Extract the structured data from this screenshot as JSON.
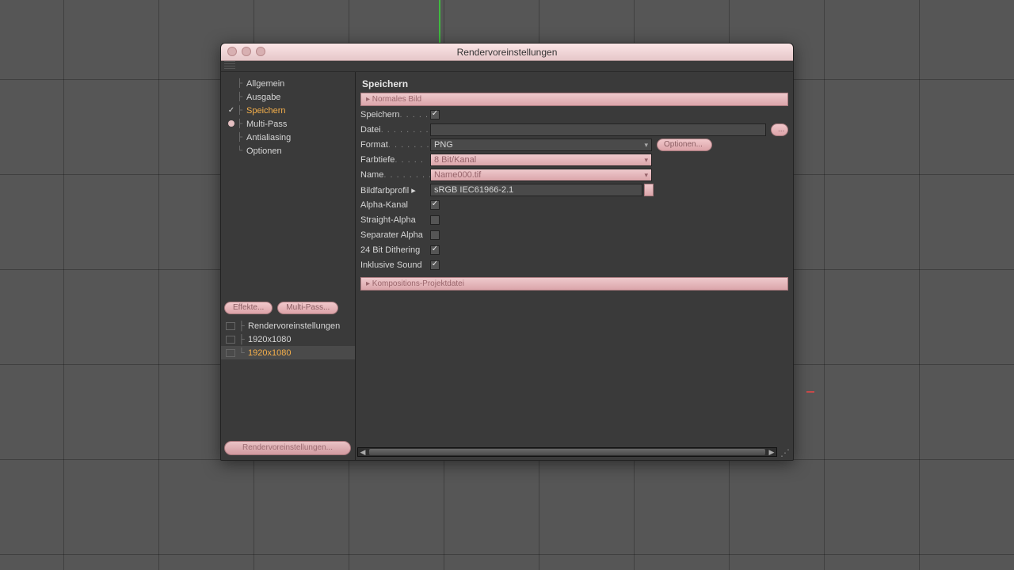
{
  "window": {
    "title": "Rendervoreinstellungen"
  },
  "nav": {
    "items": [
      {
        "label": "Allgemein",
        "check": "",
        "active": false
      },
      {
        "label": "Ausgabe",
        "check": "",
        "active": false
      },
      {
        "label": "Speichern",
        "check": "✓",
        "active": true
      },
      {
        "label": "Multi-Pass",
        "check": "radio",
        "active": false
      },
      {
        "label": "Antialiasing",
        "check": "",
        "active": false
      },
      {
        "label": "Optionen",
        "check": "",
        "active": false
      }
    ]
  },
  "side_buttons": {
    "effects": "Effekte...",
    "multipass": "Multi-Pass..."
  },
  "presets": {
    "items": [
      {
        "label": "Rendervoreinstellungen",
        "active": false
      },
      {
        "label": "1920x1080",
        "active": false
      },
      {
        "label": "1920x1080",
        "active": true
      }
    ]
  },
  "footer_button": "Rendervoreinstellungen...",
  "panel": {
    "title": "Speichern",
    "section1": "▸ Normales Bild",
    "rows": {
      "speichern": {
        "label": "Speichern",
        "dots": ". . . . .",
        "checked": true
      },
      "datei": {
        "label": "Datei",
        "dots": ". . . . . . . .",
        "value": "",
        "btn": "..."
      },
      "format": {
        "label": "Format",
        "dots": ". . . . . . .",
        "value": "PNG",
        "btn": "Optionen..."
      },
      "farbtiefe": {
        "label": "Farbtiefe",
        "dots": ". . . . .",
        "value": "8 Bit/Kanal"
      },
      "name": {
        "label": "Name",
        "dots": ". . . . . . . .",
        "value": "Name000.tif"
      },
      "profil": {
        "label": "Bildfarbprofil",
        "dots": "",
        "value": "sRGB IEC61966-2.1"
      },
      "alpha": {
        "label": "Alpha-Kanal",
        "checked": true
      },
      "straight": {
        "label": "Straight-Alpha",
        "checked": false
      },
      "separate": {
        "label": "Separater Alpha",
        "checked": false
      },
      "dithering": {
        "label": "24 Bit Dithering",
        "checked": true
      },
      "sound": {
        "label": "Inklusive Sound",
        "checked": true
      }
    },
    "section2": "▸ Kompositions-Projektdatei"
  }
}
